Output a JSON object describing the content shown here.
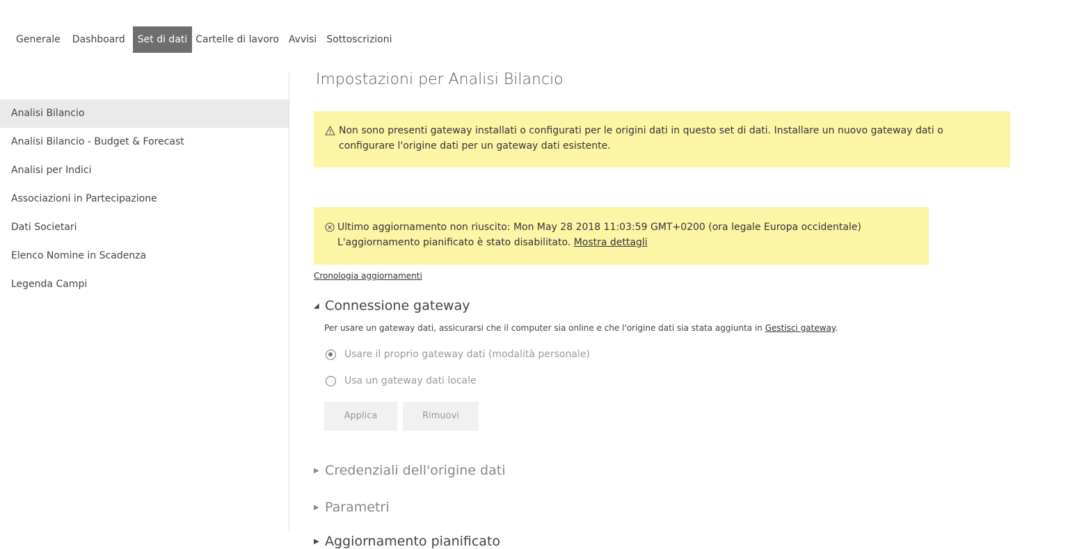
{
  "tabs": [
    {
      "label": "Generale"
    },
    {
      "label": "Dashboard"
    },
    {
      "label": "Set di dati"
    },
    {
      "label": "Cartelle di lavoro"
    },
    {
      "label": "Avvisi"
    },
    {
      "label": "Sottoscrizioni"
    }
  ],
  "active_tab": "Set di dati",
  "sidebar": {
    "items": [
      {
        "label": "Analisi Bilancio"
      },
      {
        "label": "Analisi Bilancio - Budget & Forecast"
      },
      {
        "label": "Analisi per Indici"
      },
      {
        "label": "Associazioni in Partecipazione"
      },
      {
        "label": "Dati Societari"
      },
      {
        "label": "Elenco Nomine in Scadenza"
      },
      {
        "label": "Legenda Campi"
      }
    ]
  },
  "main": {
    "title": "Impostazioni per Analisi Bilancio",
    "warning": {
      "icon": "warning-triangle-icon",
      "text": "Non sono presenti gateway installati o configurati per le origini dati in questo set di dati. Installare un nuovo gateway dati o configurare l'origine dati per un gateway dati esistente."
    },
    "error": {
      "icon": "error-circle-x-icon",
      "line1": "Ultimo aggiornamento non riuscito: Mon May 28 2018 11:03:59 GMT+0200 (ora legale Europa occidentale)",
      "line2": "L'aggiornamento pianificato è stato disabilitato.",
      "details_link": "Mostra dettagli"
    },
    "history_link": "Cronologia aggiornamenti",
    "gateway_section": {
      "title": "Connessione gateway",
      "description": "Per usare un gateway dati, assicurarsi che il computer sia online e che l'origine dati sia stata aggiunta in",
      "description_link": "Gestisci gateway",
      "description_end": ".",
      "options": [
        {
          "label": "Usare il proprio gateway dati (modalità personale)",
          "checked": true
        },
        {
          "label": "Usa un gateway dati locale",
          "checked": false
        }
      ],
      "apply_label": "Applica",
      "remove_label": "Rimuovi"
    },
    "collapsed_sections": [
      {
        "title": "Credenziali dell'origine dati"
      },
      {
        "title": "Parametri"
      },
      {
        "title": "Aggiornamento pianificato"
      }
    ]
  },
  "colors": {
    "banner_background": "#fdf5a6",
    "active_tab_background": "#6e6e6e",
    "active_sidebar_background": "#eaeaea"
  }
}
